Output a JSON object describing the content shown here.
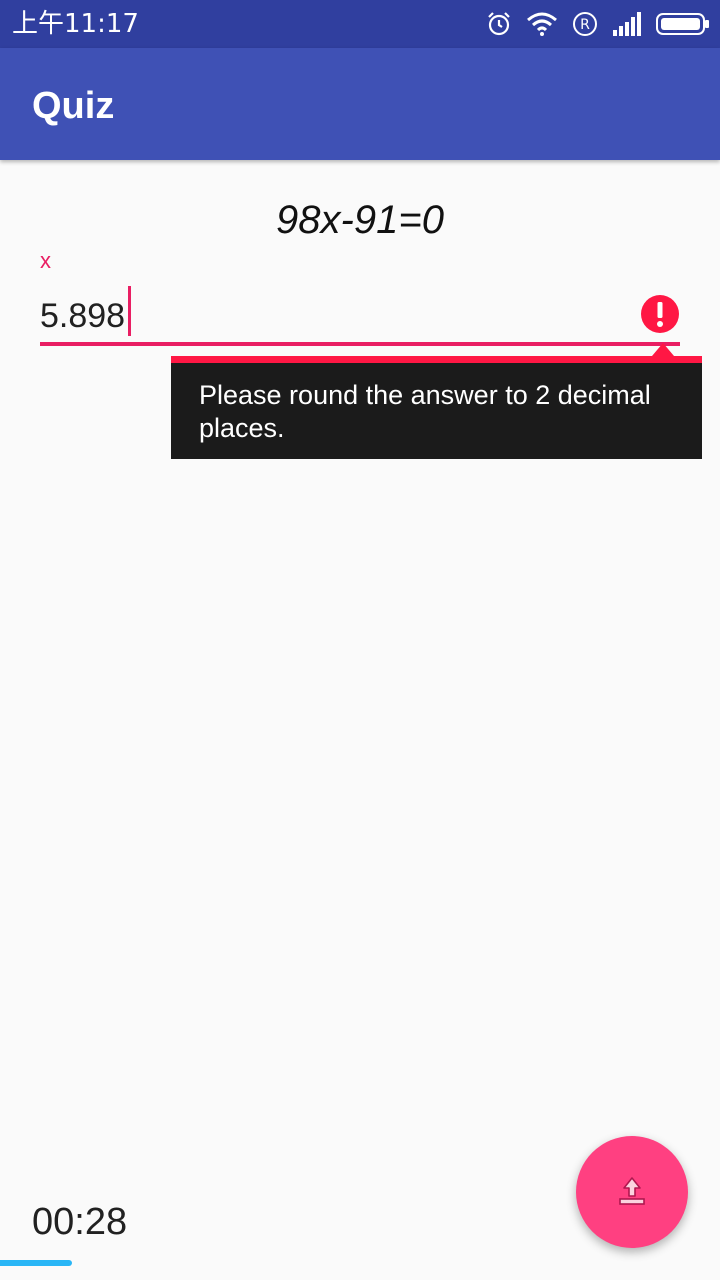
{
  "status_bar": {
    "time": "上午11:17",
    "icons": [
      "alarm-icon",
      "wifi-icon",
      "registered-icon",
      "signal-icon",
      "battery-icon"
    ]
  },
  "app_bar": {
    "title": "Quiz"
  },
  "question": {
    "equation": "98x-91=0"
  },
  "answer": {
    "label": "x",
    "value": "5.898",
    "error_message": "Please round the answer to 2 decimal places."
  },
  "timer": {
    "text": "00:28",
    "progress": 0.1
  },
  "fab": {
    "icon": "upload-icon"
  },
  "colors": {
    "status_bar": "#303f9f",
    "app_bar": "#3f51b5",
    "accent": "#ff4081",
    "error": "#ff1744",
    "progress": "#29b6f6"
  }
}
